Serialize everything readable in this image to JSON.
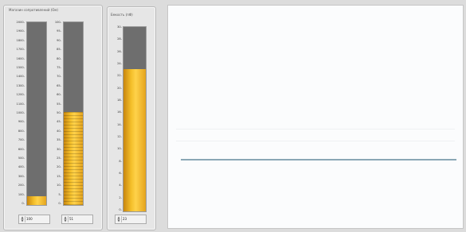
{
  "panel1": {
    "title": "Магазин сопротивлений (Ом)",
    "gauge_left": {
      "ticks": [
        "2000",
        "1900",
        "1800",
        "1700",
        "1600",
        "1500",
        "1400",
        "1300",
        "1200",
        "1100",
        "1000",
        "900",
        "800",
        "700",
        "600",
        "500",
        "400",
        "300",
        "200",
        "100",
        "0"
      ],
      "level_fraction": 0.05,
      "control_value": "100"
    },
    "gauge_right": {
      "ticks": [
        "100",
        "95",
        "90",
        "85",
        "80",
        "75",
        "70",
        "65",
        "60",
        "55",
        "50",
        "45",
        "40",
        "35",
        "30",
        "25",
        "20",
        "15",
        "10",
        "5",
        "0"
      ],
      "level_fraction": 0.51,
      "control_value": "51"
    }
  },
  "panel2": {
    "title": "Емкость (пФ)",
    "gauge": {
      "ticks": [
        "30",
        "28",
        "26",
        "24",
        "22",
        "20",
        "18",
        "16",
        "14",
        "12",
        "10",
        "8",
        "6",
        "4",
        "2",
        "0"
      ],
      "level_fraction": 0.77,
      "control_value": "23"
    }
  },
  "colors": {
    "fill": "#f4bf2a",
    "tube": "#6e6e6e",
    "trace": "#8aa7b5"
  }
}
